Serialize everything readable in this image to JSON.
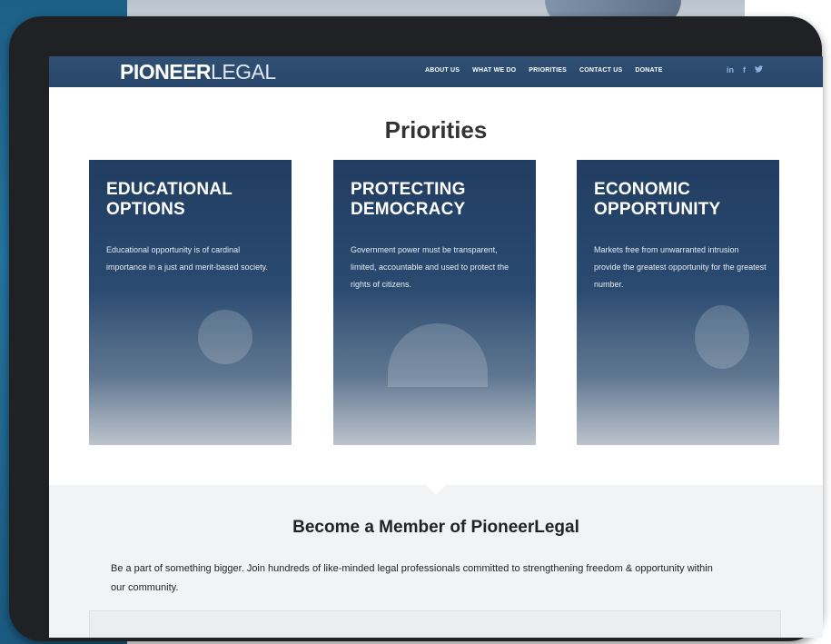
{
  "nav": {
    "logo_bold": "PIONEER",
    "logo_light": "LEGAL",
    "items": [
      "ABOUT US",
      "WHAT WE DO",
      "PRIORITIES",
      "CONTACT US",
      "DONATE"
    ],
    "social": [
      "in",
      "f",
      "t"
    ]
  },
  "priorities": {
    "title": "Priorities",
    "cards": [
      {
        "title": "EDUCATIONAL OPTIONS",
        "text": "Educational opportunity is of cardinal importance in a just and merit-based society."
      },
      {
        "title": "PROTECTING DEMOCRACY",
        "text": "Government power must be transparent, limited, accountable and used to protect the rights of citizens."
      },
      {
        "title": "ECONOMIC OPPORTUNITY",
        "text": "Markets free from unwarranted intrusion provide the greatest opportunity for the greatest number."
      }
    ]
  },
  "member": {
    "title": "Become a Member of PioneerLegal",
    "text": "Be a part of something bigger. Join hundreds of like-minded legal professionals committed to strengthening freedom & opportunity within our community."
  },
  "colors": {
    "nav": "#2f4f73",
    "card": "#213d61",
    "accent_bg": "#1d5f86"
  }
}
